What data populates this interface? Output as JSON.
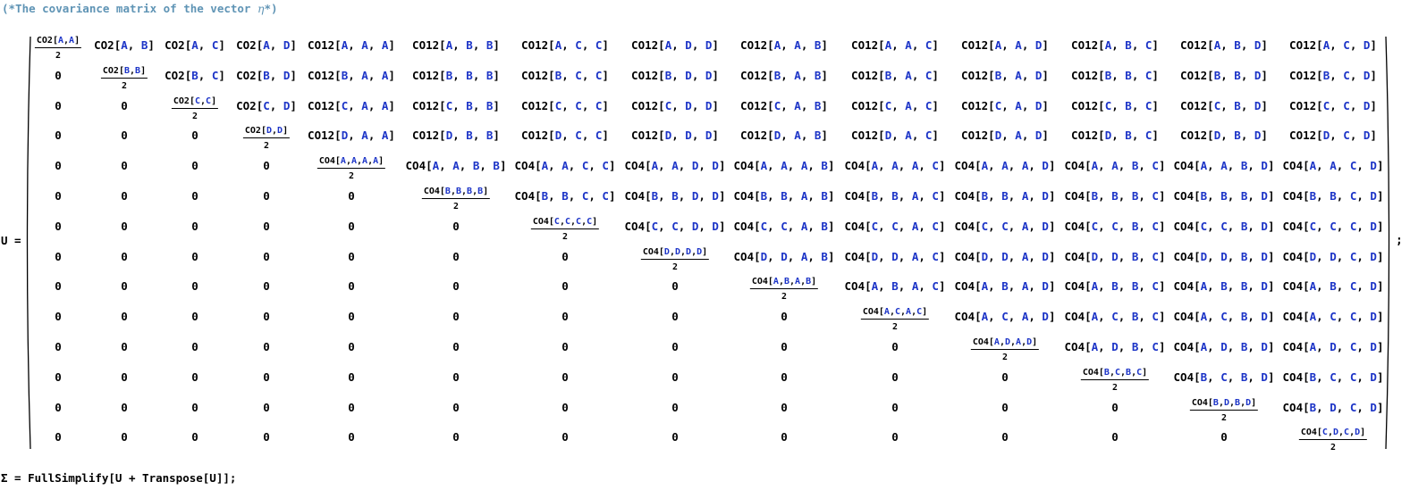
{
  "comment": {
    "prefix": "(*The covariance matrix of the vector ",
    "symbol": "η",
    "suffix": "*)"
  },
  "assignment": {
    "lhs": "U =",
    "terminator": ";"
  },
  "matrix": {
    "rows": [
      [
        [
          "frac",
          "CO2",
          "A,A"
        ],
        [
          "e",
          "CO2",
          "A",
          "B"
        ],
        [
          "e",
          "CO2",
          "A",
          "C"
        ],
        [
          "e",
          "CO2",
          "A",
          "D"
        ],
        [
          "e",
          "CO12",
          "A",
          "A",
          "A"
        ],
        [
          "e",
          "CO12",
          "A",
          "B",
          "B"
        ],
        [
          "e",
          "CO12",
          "A",
          "C",
          "C"
        ],
        [
          "e",
          "CO12",
          "A",
          "D",
          "D"
        ],
        [
          "e",
          "CO12",
          "A",
          "A",
          "B"
        ],
        [
          "e",
          "CO12",
          "A",
          "A",
          "C"
        ],
        [
          "e",
          "CO12",
          "A",
          "A",
          "D"
        ],
        [
          "e",
          "CO12",
          "A",
          "B",
          "C"
        ],
        [
          "e",
          "CO12",
          "A",
          "B",
          "D"
        ],
        [
          "e",
          "CO12",
          "A",
          "C",
          "D"
        ]
      ],
      [
        [
          "z"
        ],
        [
          "frac",
          "CO2",
          "B,B"
        ],
        [
          "e",
          "CO2",
          "B",
          "C"
        ],
        [
          "e",
          "CO2",
          "B",
          "D"
        ],
        [
          "e",
          "CO12",
          "B",
          "A",
          "A"
        ],
        [
          "e",
          "CO12",
          "B",
          "B",
          "B"
        ],
        [
          "e",
          "CO12",
          "B",
          "C",
          "C"
        ],
        [
          "e",
          "CO12",
          "B",
          "D",
          "D"
        ],
        [
          "e",
          "CO12",
          "B",
          "A",
          "B"
        ],
        [
          "e",
          "CO12",
          "B",
          "A",
          "C"
        ],
        [
          "e",
          "CO12",
          "B",
          "A",
          "D"
        ],
        [
          "e",
          "CO12",
          "B",
          "B",
          "C"
        ],
        [
          "e",
          "CO12",
          "B",
          "B",
          "D"
        ],
        [
          "e",
          "CO12",
          "B",
          "C",
          "D"
        ]
      ],
      [
        [
          "z"
        ],
        [
          "z"
        ],
        [
          "frac",
          "CO2",
          "C,C"
        ],
        [
          "e",
          "CO2",
          "C",
          "D"
        ],
        [
          "e",
          "CO12",
          "C",
          "A",
          "A"
        ],
        [
          "e",
          "CO12",
          "C",
          "B",
          "B"
        ],
        [
          "e",
          "CO12",
          "C",
          "C",
          "C"
        ],
        [
          "e",
          "CO12",
          "C",
          "D",
          "D"
        ],
        [
          "e",
          "CO12",
          "C",
          "A",
          "B"
        ],
        [
          "e",
          "CO12",
          "C",
          "A",
          "C"
        ],
        [
          "e",
          "CO12",
          "C",
          "A",
          "D"
        ],
        [
          "e",
          "CO12",
          "C",
          "B",
          "C"
        ],
        [
          "e",
          "CO12",
          "C",
          "B",
          "D"
        ],
        [
          "e",
          "CO12",
          "C",
          "C",
          "D"
        ]
      ],
      [
        [
          "z"
        ],
        [
          "z"
        ],
        [
          "z"
        ],
        [
          "frac",
          "CO2",
          "D,D"
        ],
        [
          "e",
          "CO12",
          "D",
          "A",
          "A"
        ],
        [
          "e",
          "CO12",
          "D",
          "B",
          "B"
        ],
        [
          "e",
          "CO12",
          "D",
          "C",
          "C"
        ],
        [
          "e",
          "CO12",
          "D",
          "D",
          "D"
        ],
        [
          "e",
          "CO12",
          "D",
          "A",
          "B"
        ],
        [
          "e",
          "CO12",
          "D",
          "A",
          "C"
        ],
        [
          "e",
          "CO12",
          "D",
          "A",
          "D"
        ],
        [
          "e",
          "CO12",
          "D",
          "B",
          "C"
        ],
        [
          "e",
          "CO12",
          "D",
          "B",
          "D"
        ],
        [
          "e",
          "CO12",
          "D",
          "C",
          "D"
        ]
      ],
      [
        [
          "z"
        ],
        [
          "z"
        ],
        [
          "z"
        ],
        [
          "z"
        ],
        [
          "frac",
          "CO4",
          "A,A,A,A"
        ],
        [
          "e",
          "CO4",
          "A",
          "A",
          "B",
          "B"
        ],
        [
          "e",
          "CO4",
          "A",
          "A",
          "C",
          "C"
        ],
        [
          "e",
          "CO4",
          "A",
          "A",
          "D",
          "D"
        ],
        [
          "e",
          "CO4",
          "A",
          "A",
          "A",
          "B"
        ],
        [
          "e",
          "CO4",
          "A",
          "A",
          "A",
          "C"
        ],
        [
          "e",
          "CO4",
          "A",
          "A",
          "A",
          "D"
        ],
        [
          "e",
          "CO4",
          "A",
          "A",
          "B",
          "C"
        ],
        [
          "e",
          "CO4",
          "A",
          "A",
          "B",
          "D"
        ],
        [
          "e",
          "CO4",
          "A",
          "A",
          "C",
          "D"
        ]
      ],
      [
        [
          "z"
        ],
        [
          "z"
        ],
        [
          "z"
        ],
        [
          "z"
        ],
        [
          "z"
        ],
        [
          "frac",
          "CO4",
          "B,B,B,B"
        ],
        [
          "e",
          "CO4",
          "B",
          "B",
          "C",
          "C"
        ],
        [
          "e",
          "CO4",
          "B",
          "B",
          "D",
          "D"
        ],
        [
          "e",
          "CO4",
          "B",
          "B",
          "A",
          "B"
        ],
        [
          "e",
          "CO4",
          "B",
          "B",
          "A",
          "C"
        ],
        [
          "e",
          "CO4",
          "B",
          "B",
          "A",
          "D"
        ],
        [
          "e",
          "CO4",
          "B",
          "B",
          "B",
          "C"
        ],
        [
          "e",
          "CO4",
          "B",
          "B",
          "B",
          "D"
        ],
        [
          "e",
          "CO4",
          "B",
          "B",
          "C",
          "D"
        ]
      ],
      [
        [
          "z"
        ],
        [
          "z"
        ],
        [
          "z"
        ],
        [
          "z"
        ],
        [
          "z"
        ],
        [
          "z"
        ],
        [
          "frac",
          "CO4",
          "C,C,C,C"
        ],
        [
          "e",
          "CO4",
          "C",
          "C",
          "D",
          "D"
        ],
        [
          "e",
          "CO4",
          "C",
          "C",
          "A",
          "B"
        ],
        [
          "e",
          "CO4",
          "C",
          "C",
          "A",
          "C"
        ],
        [
          "e",
          "CO4",
          "C",
          "C",
          "A",
          "D"
        ],
        [
          "e",
          "CO4",
          "C",
          "C",
          "B",
          "C"
        ],
        [
          "e",
          "CO4",
          "C",
          "C",
          "B",
          "D"
        ],
        [
          "e",
          "CO4",
          "C",
          "C",
          "C",
          "D"
        ]
      ],
      [
        [
          "z"
        ],
        [
          "z"
        ],
        [
          "z"
        ],
        [
          "z"
        ],
        [
          "z"
        ],
        [
          "z"
        ],
        [
          "z"
        ],
        [
          "frac",
          "CO4",
          "D,D,D,D"
        ],
        [
          "e",
          "CO4",
          "D",
          "D",
          "A",
          "B"
        ],
        [
          "e",
          "CO4",
          "D",
          "D",
          "A",
          "C"
        ],
        [
          "e",
          "CO4",
          "D",
          "D",
          "A",
          "D"
        ],
        [
          "e",
          "CO4",
          "D",
          "D",
          "B",
          "C"
        ],
        [
          "e",
          "CO4",
          "D",
          "D",
          "B",
          "D"
        ],
        [
          "e",
          "CO4",
          "D",
          "D",
          "C",
          "D"
        ]
      ],
      [
        [
          "z"
        ],
        [
          "z"
        ],
        [
          "z"
        ],
        [
          "z"
        ],
        [
          "z"
        ],
        [
          "z"
        ],
        [
          "z"
        ],
        [
          "z"
        ],
        [
          "frac",
          "CO4",
          "A,B,A,B"
        ],
        [
          "e",
          "CO4",
          "A",
          "B",
          "A",
          "C"
        ],
        [
          "e",
          "CO4",
          "A",
          "B",
          "A",
          "D"
        ],
        [
          "e",
          "CO4",
          "A",
          "B",
          "B",
          "C"
        ],
        [
          "e",
          "CO4",
          "A",
          "B",
          "B",
          "D"
        ],
        [
          "e",
          "CO4",
          "A",
          "B",
          "C",
          "D"
        ]
      ],
      [
        [
          "z"
        ],
        [
          "z"
        ],
        [
          "z"
        ],
        [
          "z"
        ],
        [
          "z"
        ],
        [
          "z"
        ],
        [
          "z"
        ],
        [
          "z"
        ],
        [
          "z"
        ],
        [
          "frac",
          "CO4",
          "A,C,A,C"
        ],
        [
          "e",
          "CO4",
          "A",
          "C",
          "A",
          "D"
        ],
        [
          "e",
          "CO4",
          "A",
          "C",
          "B",
          "C"
        ],
        [
          "e",
          "CO4",
          "A",
          "C",
          "B",
          "D"
        ],
        [
          "e",
          "CO4",
          "A",
          "C",
          "C",
          "D"
        ]
      ],
      [
        [
          "z"
        ],
        [
          "z"
        ],
        [
          "z"
        ],
        [
          "z"
        ],
        [
          "z"
        ],
        [
          "z"
        ],
        [
          "z"
        ],
        [
          "z"
        ],
        [
          "z"
        ],
        [
          "z"
        ],
        [
          "frac",
          "CO4",
          "A,D,A,D"
        ],
        [
          "e",
          "CO4",
          "A",
          "D",
          "B",
          "C"
        ],
        [
          "e",
          "CO4",
          "A",
          "D",
          "B",
          "D"
        ],
        [
          "e",
          "CO4",
          "A",
          "D",
          "C",
          "D"
        ]
      ],
      [
        [
          "z"
        ],
        [
          "z"
        ],
        [
          "z"
        ],
        [
          "z"
        ],
        [
          "z"
        ],
        [
          "z"
        ],
        [
          "z"
        ],
        [
          "z"
        ],
        [
          "z"
        ],
        [
          "z"
        ],
        [
          "z"
        ],
        [
          "frac",
          "CO4",
          "B,C,B,C"
        ],
        [
          "e",
          "CO4",
          "B",
          "C",
          "B",
          "D"
        ],
        [
          "e",
          "CO4",
          "B",
          "C",
          "C",
          "D"
        ]
      ],
      [
        [
          "z"
        ],
        [
          "z"
        ],
        [
          "z"
        ],
        [
          "z"
        ],
        [
          "z"
        ],
        [
          "z"
        ],
        [
          "z"
        ],
        [
          "z"
        ],
        [
          "z"
        ],
        [
          "z"
        ],
        [
          "z"
        ],
        [
          "z"
        ],
        [
          "frac",
          "CO4",
          "B,D,B,D"
        ],
        [
          "e",
          "CO4",
          "B",
          "D",
          "C",
          "D"
        ]
      ],
      [
        [
          "z"
        ],
        [
          "z"
        ],
        [
          "z"
        ],
        [
          "z"
        ],
        [
          "z"
        ],
        [
          "z"
        ],
        [
          "z"
        ],
        [
          "z"
        ],
        [
          "z"
        ],
        [
          "z"
        ],
        [
          "z"
        ],
        [
          "z"
        ],
        [
          "z"
        ],
        [
          "frac",
          "CO4",
          "C,D,C,D"
        ]
      ]
    ],
    "zero": "0",
    "denominator": "2"
  },
  "bottom_expression": "Σ = FullSimplify[U + Transpose[U]];",
  "colors": {
    "variable": "#1c34c7",
    "comment": "#5f94b5",
    "text": "#000000"
  }
}
